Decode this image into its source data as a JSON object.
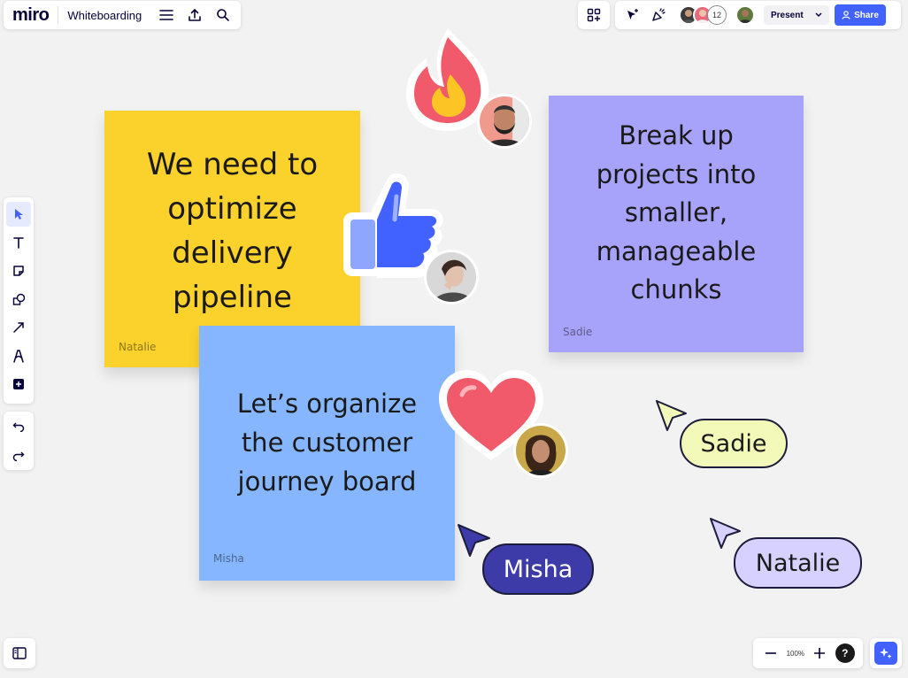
{
  "app": {
    "logo": "miro",
    "board_name": "Whiteboarding"
  },
  "topbar": {
    "collaborator_count": "12",
    "present_label": "Present",
    "share_label": "Share"
  },
  "toolbar": {
    "tools": [
      "select-icon",
      "text-icon",
      "sticky-note-icon",
      "shapes-icon",
      "arrow-icon",
      "pen-icon",
      "add-icon"
    ],
    "history": [
      "undo-icon",
      "redo-icon"
    ]
  },
  "zoom": {
    "level": "100%",
    "help": "?"
  },
  "notes": [
    {
      "text": "We need to\noptimize\ndelivery\npipeline",
      "author": "Natalie",
      "color": "#fbd22b"
    },
    {
      "text": "Break up\nprojects into\nsmaller,\nmanageable\nchunks",
      "author": "Sadie",
      "color": "#a8a3fa"
    },
    {
      "text": "Let’s organize\nthe customer\njourney board",
      "author": "Misha",
      "color": "#86b6ff"
    }
  ],
  "reactions": [
    "fire-icon",
    "thumbs-up-icon",
    "heart-icon"
  ],
  "cursors": [
    {
      "name": "Misha",
      "color": "#3d3ba8"
    },
    {
      "name": "Sadie",
      "color": "#f3f9b8"
    },
    {
      "name": "Natalie",
      "color": "#d6d1ff"
    }
  ],
  "colors": {
    "accent": "#4262ff",
    "canvas": "#f2f2f2"
  }
}
